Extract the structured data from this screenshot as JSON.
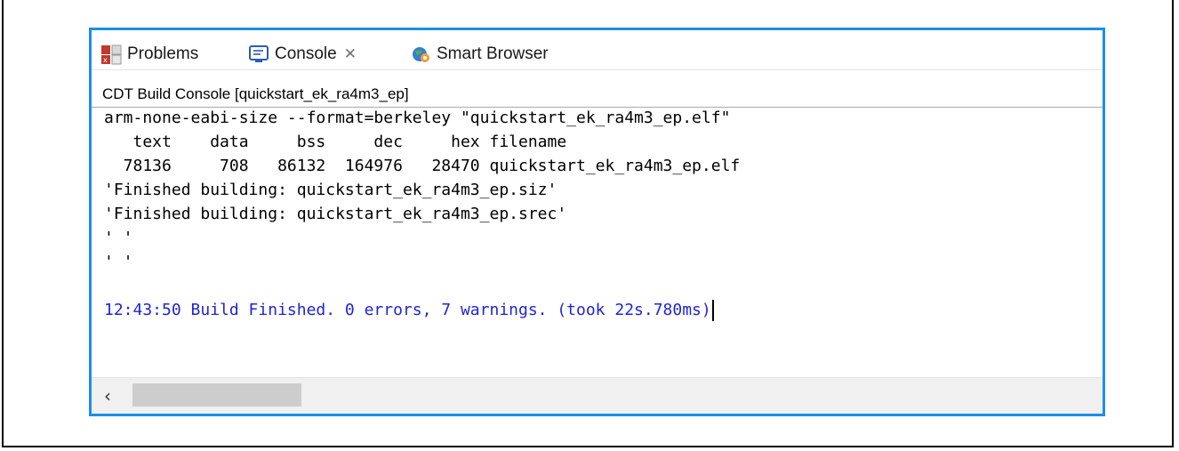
{
  "tabs": [
    {
      "label": "Problems",
      "icon": "problems-icon",
      "active": false
    },
    {
      "label": "Console",
      "icon": "console-icon",
      "active": true,
      "close_glyph": "✕"
    },
    {
      "label": "Smart Browser",
      "icon": "smart-browser-icon",
      "active": false
    }
  ],
  "console": {
    "title": "CDT Build Console [quickstart_ek_ra4m3_ep]",
    "lines": [
      "arm-none-eabi-size --format=berkeley \"quickstart_ek_ra4m3_ep.elf\"",
      "   text    data     bss     dec     hex filename",
      "  78136     708   86132  164976   28470 quickstart_ek_ra4m3_ep.elf",
      "'Finished building: quickstart_ek_ra4m3_ep.siz'",
      "'Finished building: quickstart_ek_ra4m3_ep.srec'",
      "' '",
      "' '",
      "",
      "12:43:50 Build Finished. 0 errors, 7 warnings. (took 22s.780ms)"
    ]
  },
  "scrollbar": {
    "left_arrow": "‹"
  },
  "colors": {
    "focus_border": "#1b8fe6",
    "status_text": "#1f24d6"
  }
}
